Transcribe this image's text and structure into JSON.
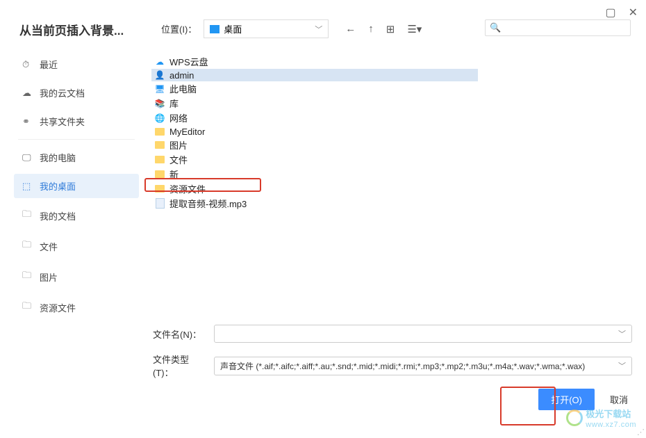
{
  "window": {
    "title": "从当前页插入背景..."
  },
  "toolbar": {
    "location_label": "位置(I)：",
    "location_value": "桌面"
  },
  "sidebar": {
    "items": [
      {
        "icon": "⏱",
        "label": "最近"
      },
      {
        "icon": "☁",
        "label": "我的云文档"
      },
      {
        "icon": "⚭",
        "label": "共享文件夹"
      },
      {
        "icon": "🖵",
        "label": "我的电脑"
      },
      {
        "icon": "⬚",
        "label": "我的桌面"
      },
      {
        "icon": "🗀",
        "label": "我的文档"
      },
      {
        "icon": "🗀",
        "label": "文件"
      },
      {
        "icon": "🗀",
        "label": "图片"
      },
      {
        "icon": "🗀",
        "label": "资源文件"
      }
    ]
  },
  "files": {
    "items": [
      {
        "label": "WPS云盘"
      },
      {
        "label": "admin"
      },
      {
        "label": "此电脑"
      },
      {
        "label": "库"
      },
      {
        "label": "网络"
      },
      {
        "label": "MyEditor"
      },
      {
        "label": "图片"
      },
      {
        "label": "文件"
      },
      {
        "label": "新"
      },
      {
        "label": "资源文件"
      },
      {
        "label": "提取音频-视频.mp3"
      }
    ]
  },
  "form": {
    "filename_label": "文件名(N)：",
    "filename_value": "",
    "filetype_label": "文件类型(T)：",
    "filetype_value": "声音文件 (*.aif;*.aifc;*.aiff;*.au;*.snd;*.mid;*.midi;*.rmi;*.mp3;*.mp2;*.m3u;*.m4a;*.wav;*.wma;*.wax)",
    "open_label": "打开(O)",
    "cancel_label": "取消"
  },
  "watermark": {
    "name": "极光下载站",
    "url": "www.xz7.com"
  }
}
